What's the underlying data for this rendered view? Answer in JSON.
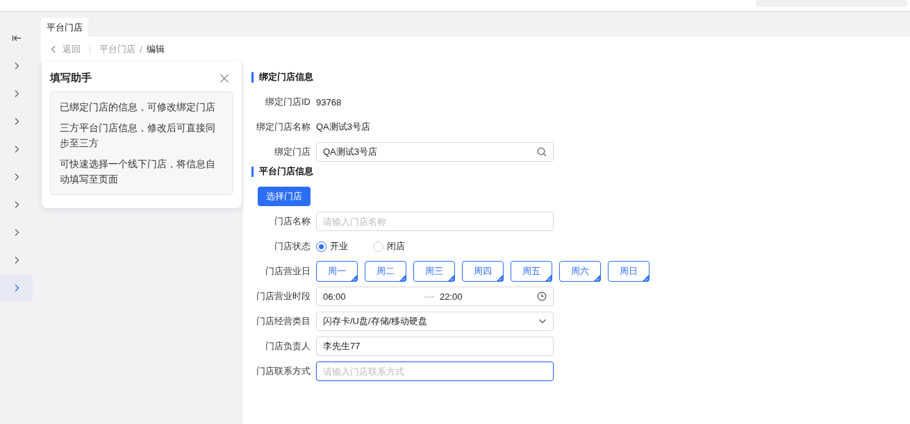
{
  "sidebar": {
    "items": [
      {
        "selected": false
      },
      {
        "selected": false
      },
      {
        "selected": false
      },
      {
        "selected": false
      },
      {
        "selected": false
      },
      {
        "selected": false
      },
      {
        "selected": false
      },
      {
        "selected": false
      },
      {
        "selected": true
      }
    ]
  },
  "tabs": [
    {
      "label": "平台门店",
      "selected": true
    }
  ],
  "breadcrumb": {
    "back": "返回",
    "separator": "/",
    "items": [
      "平台门店",
      "编辑"
    ]
  },
  "helper": {
    "title": "填写助手",
    "tips": [
      "已绑定门店的信息，可修改绑定门店",
      "三方平台门店信息，修改后可直接同步至三方",
      "可快速选择一个线下门店，将信息自动填写至页面"
    ]
  },
  "form": {
    "sections": [
      {
        "title": "绑定门店信息",
        "fields": [
          {
            "kind": "text",
            "label": "绑定门店ID",
            "value": "93768"
          },
          {
            "kind": "text",
            "label": "绑定门店名称",
            "value": "QA测试3号店"
          },
          {
            "kind": "search",
            "label": "绑定门店",
            "value": "QA测试3号店"
          }
        ]
      },
      {
        "title": "平台门店信息",
        "fields": [
          {
            "kind": "button",
            "text": "选择门店"
          },
          {
            "kind": "input",
            "label": "门店名称",
            "placeholder": "请输入门店名称",
            "focused": false
          },
          {
            "kind": "radio",
            "label": "门店状态",
            "options": [
              {
                "label": "开业",
                "selected": true
              },
              {
                "label": "闭店",
                "selected": false
              }
            ]
          },
          {
            "kind": "tags",
            "label": "门店营业日",
            "options": [
              {
                "label": "周一",
                "selected": true
              },
              {
                "label": "周二",
                "selected": true
              },
              {
                "label": "周三",
                "selected": true
              },
              {
                "label": "周四",
                "selected": true
              },
              {
                "label": "周五",
                "selected": true
              },
              {
                "label": "周六",
                "selected": true
              },
              {
                "label": "周日",
                "selected": true
              }
            ]
          },
          {
            "kind": "timerange",
            "label": "门店营业时段",
            "start": "06:00",
            "end": "22:00"
          },
          {
            "kind": "select",
            "label": "门店经营类目",
            "value": "闪存卡/U盘/存储/移动硬盘"
          },
          {
            "kind": "input",
            "label": "门店负责人",
            "value": "李先生77",
            "focused": false
          },
          {
            "kind": "input",
            "label": "门店联系方式",
            "placeholder": "请输入门店联系方式",
            "focused": true
          }
        ]
      }
    ]
  }
}
